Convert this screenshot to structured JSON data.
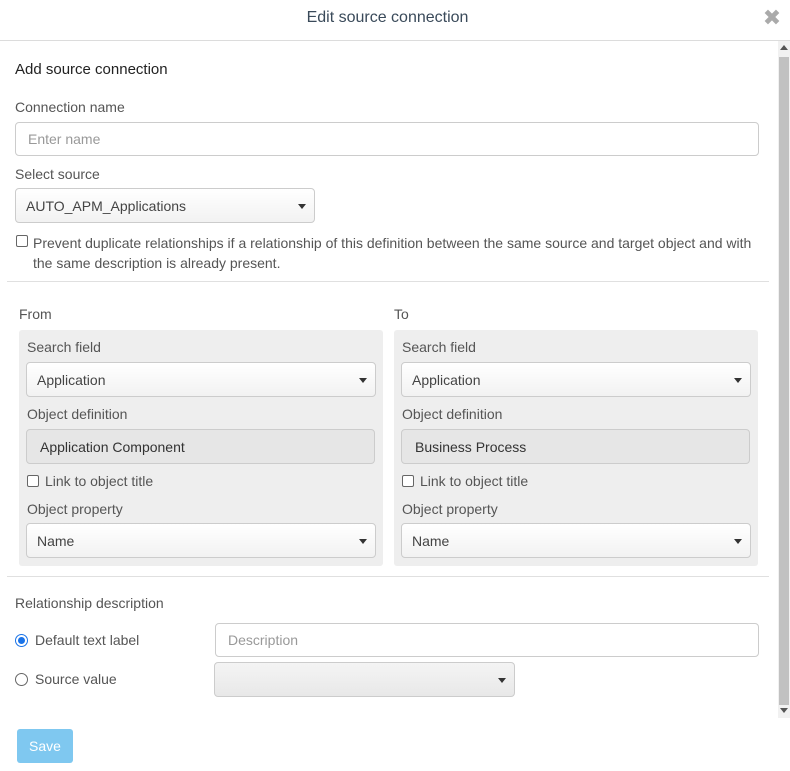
{
  "dialog": {
    "title": "Edit source connection",
    "close_glyph": "✖"
  },
  "form": {
    "section_title": "Add source connection",
    "connection_name": {
      "label": "Connection name",
      "value": "",
      "placeholder": "Enter name"
    },
    "select_source": {
      "label": "Select source",
      "value": "AUTO_APM_Applications"
    },
    "prevent_duplicates": {
      "checked": false,
      "label_line1": "Prevent duplicate relationships if a relationship of this definition between the same source and target object and with",
      "label_line2": "the same description is already present."
    },
    "from": {
      "heading": "From",
      "search_field_label": "Search field",
      "search_field_value": "Application",
      "object_definition_label": "Object definition",
      "object_definition_value": "Application Component",
      "link_to_title_label": "Link to object title",
      "link_to_title_checked": false,
      "object_property_label": "Object property",
      "object_property_value": "Name"
    },
    "to": {
      "heading": "To",
      "search_field_label": "Search field",
      "search_field_value": "Application",
      "object_definition_label": "Object definition",
      "object_definition_value": "Business Process",
      "link_to_title_label": "Link to object title",
      "link_to_title_checked": false,
      "object_property_label": "Object property",
      "object_property_value": "Name"
    },
    "relationship_description": {
      "label": "Relationship description",
      "default_text_option": "Default text label",
      "default_text_selected": true,
      "description_placeholder": "Description",
      "source_value_option": "Source value",
      "source_value_selected": false,
      "source_value_value": ""
    },
    "save_label": "Save"
  },
  "colors": {
    "accent": "#1a73e8",
    "save_button": "#7fc8f0",
    "panel_bg": "#eeeeee"
  }
}
